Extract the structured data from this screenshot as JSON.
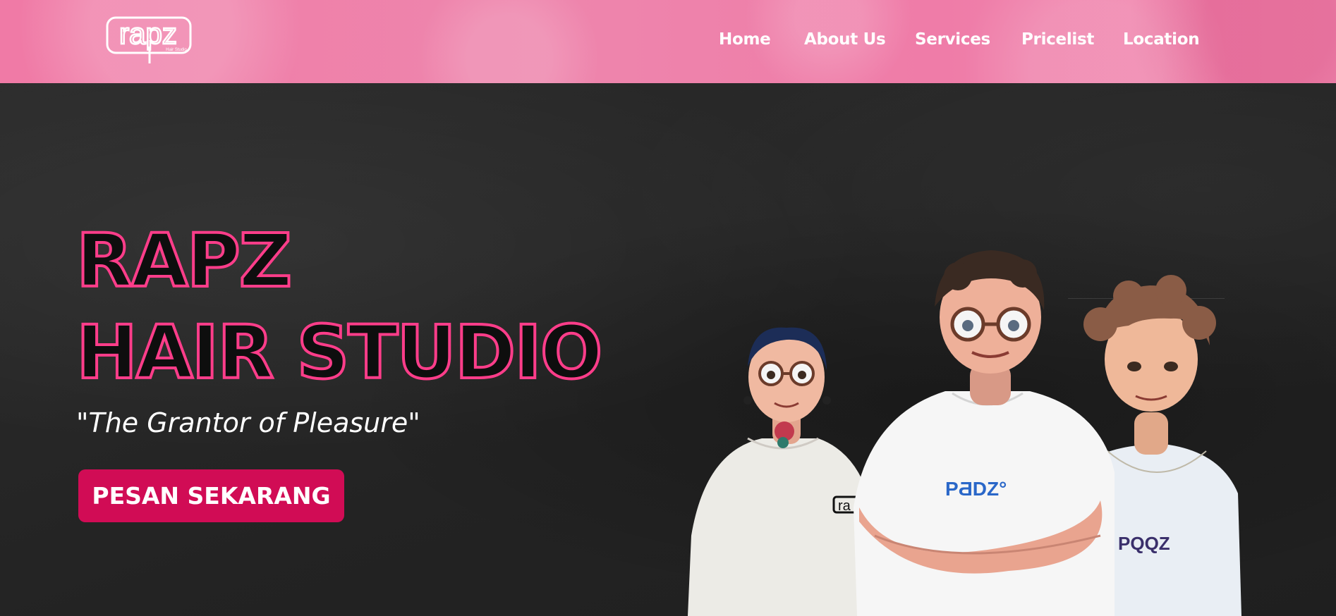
{
  "header": {
    "logo": {
      "text": "rapz",
      "subtext": "Hair Studio",
      "icon": "rapz-logo"
    },
    "nav": [
      {
        "label": "Home"
      },
      {
        "label": "About Us"
      },
      {
        "label": "Services"
      },
      {
        "label": "Pricelist"
      },
      {
        "label": "Location"
      }
    ]
  },
  "hero": {
    "title_line1": "RAPZ",
    "title_line2": "HAIR STUDIO",
    "tagline": "\"The Grantor of Pleasure\"",
    "cta_label": "PESAN SEKARANG",
    "illustration": "three-cartoon-barbers",
    "shirt_texts": [
      "ra",
      "PƋDZ°",
      "PQQZ"
    ]
  },
  "colors": {
    "header_pink": "#ee86ad",
    "accent_pink": "#ff3d8a",
    "button": "#d10c55",
    "background": "#262626"
  }
}
